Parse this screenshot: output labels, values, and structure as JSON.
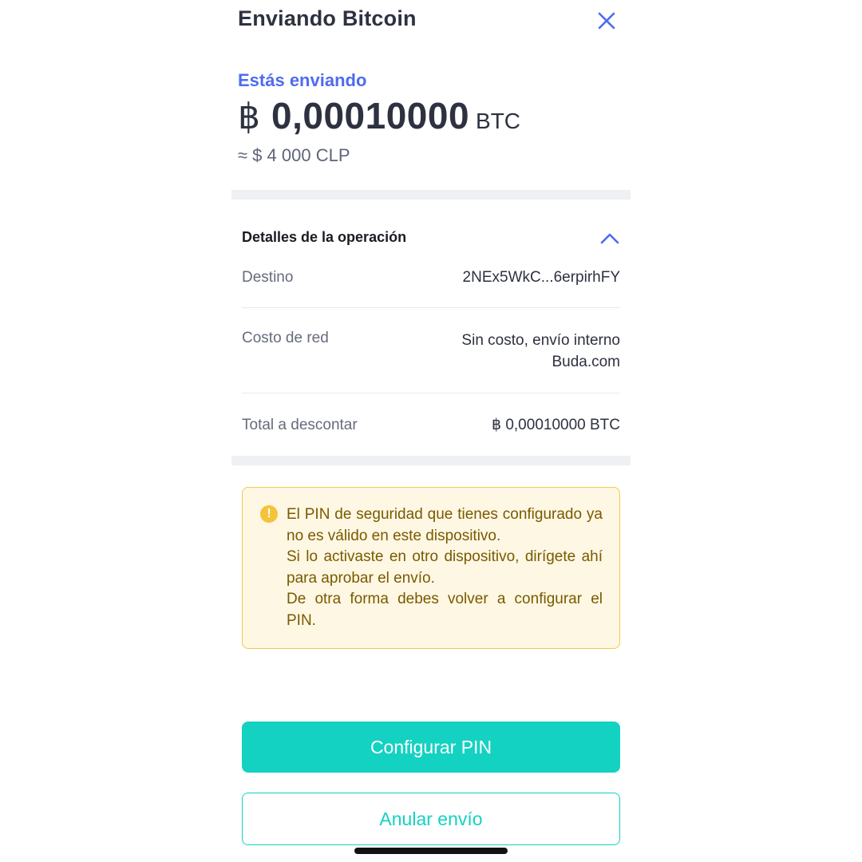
{
  "header": {
    "title": "Enviando Bitcoin",
    "close_icon": "close-icon"
  },
  "summary": {
    "sending_label": "Estás enviando",
    "currency_symbol": "฿",
    "amount": "0,00010000",
    "unit": "BTC",
    "fiat_equivalent": "≈ $ 4 000 CLP"
  },
  "details": {
    "title": "Detalles de la operación",
    "expanded": true,
    "rows": [
      {
        "label": "Destino",
        "value": "2NEx5WkC...6erpirhFY"
      },
      {
        "label": "Costo de red",
        "value_line1": "Sin costo, envío interno",
        "value_line2": "Buda.com"
      },
      {
        "label": "Total a descontar",
        "value": "฿ 0,00010000 BTC"
      }
    ]
  },
  "warning": {
    "icon": "exclamation-icon",
    "line1": "El PIN de seguridad que tienes configurado ya no es válido en este dispositivo.",
    "line2": "Si lo activaste en otro dispositivo, dirígete ahí para aprobar el envío.",
    "line3": "De otra forma debes volver a configurar el PIN."
  },
  "actions": {
    "primary_label": "Configurar PIN",
    "secondary_label": "Anular envío"
  },
  "colors": {
    "accent_blue": "#4f6bf0",
    "teal": "#14d2c2",
    "warning_bg": "#fdf7e3",
    "warning_border": "#f2c94c",
    "warning_text": "#7a5a00",
    "band_gray": "#eff0f4"
  }
}
